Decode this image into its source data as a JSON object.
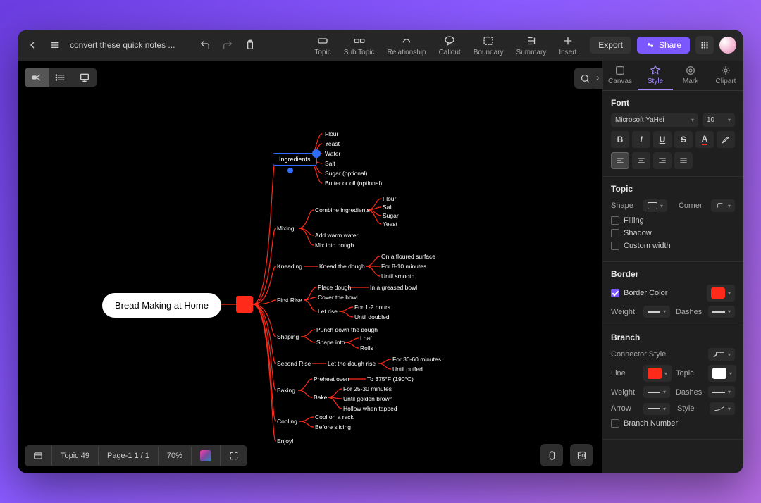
{
  "topbar": {
    "filename": "convert these quick notes ...",
    "tools": {
      "topic": "Topic",
      "subtopic": "Sub Topic",
      "relationship": "Relationship",
      "callout": "Callout",
      "boundary": "Boundary",
      "summary": "Summary",
      "insert": "Insert"
    },
    "export": "Export",
    "share": "Share"
  },
  "status": {
    "topic_count": "Topic 49",
    "page": "Page-1  1 / 1",
    "zoom": "70%"
  },
  "sidepanel": {
    "tabs": {
      "canvas": "Canvas",
      "style": "Style",
      "mark": "Mark",
      "clipart": "Clipart"
    },
    "font": {
      "title": "Font",
      "family": "Microsoft YaHei",
      "size": "10"
    },
    "topic": {
      "title": "Topic",
      "shape_label": "Shape",
      "corner_label": "Corner",
      "filling": "Filling",
      "shadow": "Shadow",
      "custom_width": "Custom width"
    },
    "border": {
      "title": "Border",
      "color_label": "Border Color",
      "color": "#ff2a1a",
      "weight_label": "Weight",
      "dashes_label": "Dashes"
    },
    "branch": {
      "title": "Branch",
      "connector_label": "Connector Style",
      "line_label": "Line",
      "topic_label": "Topic",
      "line_color": "#ff2a1a",
      "topic_color": "#ffffff",
      "weight_label": "Weight",
      "dashes_label": "Dashes",
      "arrow_label": "Arrow",
      "style_label": "Style",
      "branch_number": "Branch Number"
    }
  },
  "mindmap": {
    "root": "Bread Making at Home",
    "branches": [
      {
        "label": "Ingredients",
        "selected": true,
        "children": [
          {
            "label": "Flour"
          },
          {
            "label": "Yeast"
          },
          {
            "label": "Water"
          },
          {
            "label": "Salt"
          },
          {
            "label": "Sugar (optional)"
          },
          {
            "label": "Butter or oil (optional)"
          }
        ]
      },
      {
        "label": "Mixing",
        "children": [
          {
            "label": "Combine ingredients",
            "children": [
              {
                "label": "Flour"
              },
              {
                "label": "Salt"
              },
              {
                "label": "Sugar"
              },
              {
                "label": "Yeast"
              }
            ]
          },
          {
            "label": "Add warm water"
          },
          {
            "label": "Mix into dough"
          }
        ]
      },
      {
        "label": "Kneading",
        "children": [
          {
            "label": "Knead the dough",
            "children": [
              {
                "label": "On a floured surface"
              },
              {
                "label": "For 8-10 minutes"
              },
              {
                "label": "Until smooth"
              }
            ]
          }
        ]
      },
      {
        "label": "First Rise",
        "children": [
          {
            "label": "Place dough",
            "children": [
              {
                "label": "In a greased bowl"
              }
            ]
          },
          {
            "label": "Cover the bowl"
          },
          {
            "label": "Let rise",
            "children": [
              {
                "label": "For 1-2 hours"
              },
              {
                "label": "Until doubled"
              }
            ]
          }
        ]
      },
      {
        "label": "Shaping",
        "children": [
          {
            "label": "Punch down the dough"
          },
          {
            "label": "Shape into",
            "children": [
              {
                "label": "Loaf"
              },
              {
                "label": "Rolls"
              }
            ]
          }
        ]
      },
      {
        "label": "Second Rise",
        "children": [
          {
            "label": "Let the dough rise",
            "children": [
              {
                "label": "For 30-60 minutes"
              },
              {
                "label": "Until puffed"
              }
            ]
          }
        ]
      },
      {
        "label": "Baking",
        "children": [
          {
            "label": "Preheat oven",
            "children": [
              {
                "label": "To 375°F (190°C)"
              }
            ]
          },
          {
            "label": "Bake",
            "children": [
              {
                "label": "For 25-30 minutes"
              },
              {
                "label": "Until golden brown"
              },
              {
                "label": "Hollow when tapped"
              }
            ]
          }
        ]
      },
      {
        "label": "Cooling",
        "children": [
          {
            "label": "Cool on a rack"
          },
          {
            "label": "Before slicing"
          }
        ]
      },
      {
        "label": "Enjoy!"
      }
    ]
  }
}
